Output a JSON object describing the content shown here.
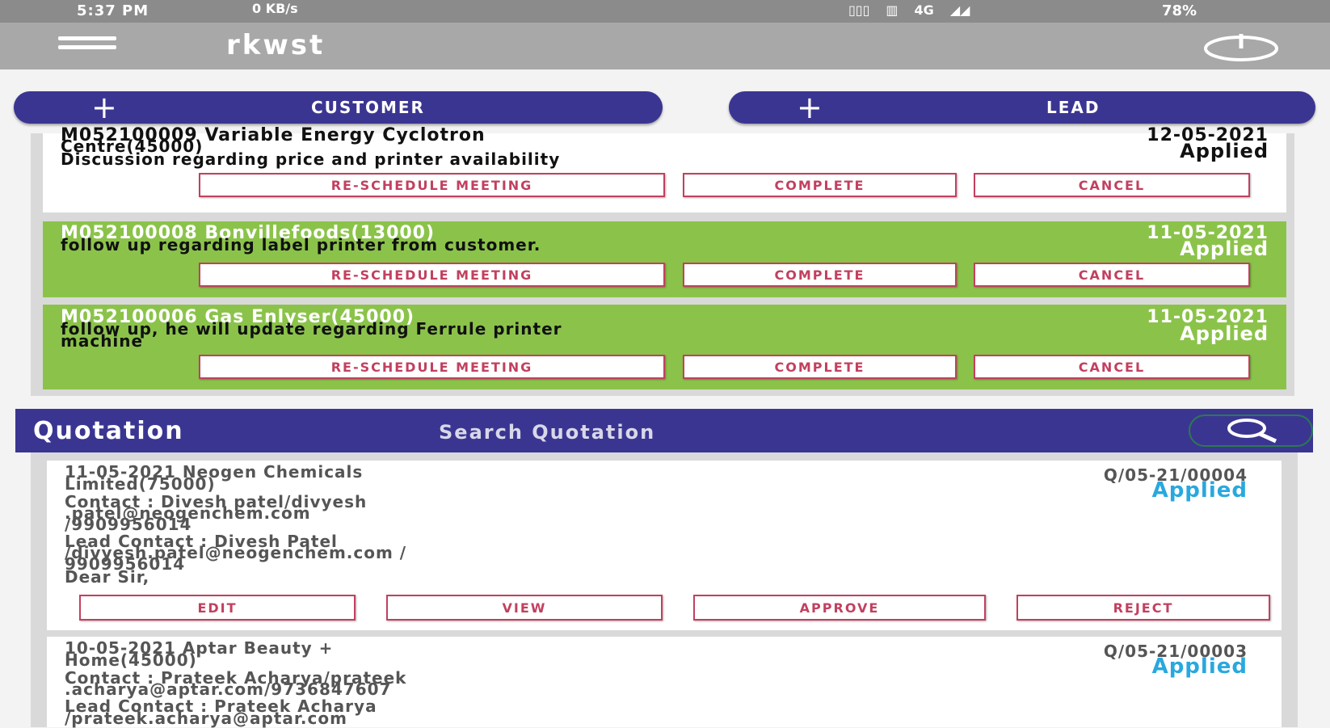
{
  "status_bar": {
    "time": "5:37 PM",
    "download_label": "0 KB/s",
    "network": "4G",
    "battery": "78%"
  },
  "app_bar": {
    "title": "rkwst"
  },
  "actions": {
    "customer_label": "CUSTOMER",
    "lead_label": "LEAD",
    "plus": "+"
  },
  "meetings": [
    {
      "id_name": "M052100009   Variable Energy Cyclotron",
      "id_name_2": "Centre(45000)",
      "description": "Discussion regarding price and printer availability",
      "date": "12-05-2021",
      "status": "Applied",
      "color": "#ffffff"
    },
    {
      "id_name": "M052100008   Bonvillefoods(13000)",
      "description": "follow up regarding label printer from customer.",
      "date": "11-05-2021",
      "status": "Applied",
      "color": "#8bc34a"
    },
    {
      "id_name": "M052100006   Gas Enlyser(45000)",
      "description": "follow up, he will update regarding Ferrule printer",
      "description_2": "machine",
      "date": "11-05-2021",
      "status": "Applied",
      "color": "#8bc34a"
    }
  ],
  "meeting_buttons": {
    "reschedule": "RE-SCHEDULE MEETING",
    "complete": "COMPLETE",
    "cancel": "CANCEL"
  },
  "quotation": {
    "title": "Quotation",
    "search_placeholder": "Search Quotation",
    "items": [
      {
        "line1": "11-05-2021 Neogen Chemicals",
        "line2": "Limited(75000)",
        "contact1": "Contact : Divesh patel/divyesh",
        "contact2": ".patel@neogenchem.com",
        "contact3": "/9909956014",
        "lead1": "Lead Contact : Divesh Patel",
        "lead2": "/divyesh.patel@neogenchem.com /",
        "lead3": "9909956014",
        "note": "Dear Sir,",
        "code": "Q/05-21/00004",
        "status": "Applied"
      },
      {
        "line1": "10-05-2021 Aptar Beauty +",
        "line2": "Home(45000)",
        "contact1": "Contact : Prateek Acharya/prateek",
        "contact2": ".acharya@aptar.com/9736847607",
        "lead1": "Lead Contact : Prateek Acharya",
        "lead2": "/prateek.acharya@aptar.com",
        "code": "Q/05-21/00003",
        "status": "Applied"
      }
    ],
    "buttons": {
      "edit": "EDIT",
      "view": "VIEW",
      "approve": "APPROVE",
      "reject": "REJECT"
    }
  },
  "colors": {
    "primary": "#3b3592",
    "accent_green": "#8bc34a",
    "outline_red": "#c2405f",
    "status_blue": "#29a8de"
  }
}
